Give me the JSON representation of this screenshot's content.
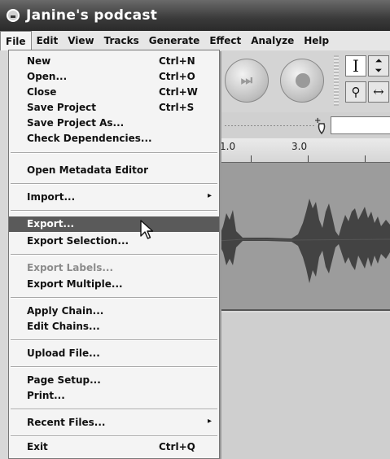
{
  "window": {
    "title": "Janine's podcast",
    "icon": "audacity-app-icon"
  },
  "menubar": {
    "items": [
      {
        "label": "File",
        "active": true
      },
      {
        "label": "Edit"
      },
      {
        "label": "View"
      },
      {
        "label": "Tracks"
      },
      {
        "label": "Generate"
      },
      {
        "label": "Effect"
      },
      {
        "label": "Analyze"
      },
      {
        "label": "Help"
      }
    ]
  },
  "file_menu": {
    "items": [
      {
        "label": "New",
        "accel": "Ctrl+N"
      },
      {
        "label": "Open...",
        "accel": "Ctrl+O"
      },
      {
        "label": "Close",
        "accel": "Ctrl+W"
      },
      {
        "label": "Save Project",
        "accel": "Ctrl+S"
      },
      {
        "label": "Save Project As..."
      },
      {
        "label": "Check Dependencies..."
      },
      {
        "label": "Open Metadata Editor"
      },
      {
        "label": "Import...",
        "submenu": true
      },
      {
        "label": "Export...",
        "highlighted": true
      },
      {
        "label": "Export Selection..."
      },
      {
        "label": "Export Labels...",
        "disabled": true
      },
      {
        "label": "Export Multiple..."
      },
      {
        "label": "Apply Chain..."
      },
      {
        "label": "Edit Chains..."
      },
      {
        "label": "Upload File..."
      },
      {
        "label": "Page Setup..."
      },
      {
        "label": "Print..."
      },
      {
        "label": "Recent Files...",
        "submenu": true
      },
      {
        "label": "Exit",
        "accel": "Ctrl+Q"
      }
    ],
    "submenu_arrow": "▸"
  },
  "toolbar": {
    "buttons": [
      {
        "name": "skip-to-end",
        "glyph": "⏭"
      },
      {
        "name": "record"
      }
    ],
    "tools": [
      "I",
      "⇕",
      "🔍",
      "↔"
    ]
  },
  "ruler": {
    "labels": [
      "1.0",
      "3.0"
    ]
  },
  "colors": {
    "highlight": "#5a5a5a",
    "track_bg": "#9c9c9c",
    "waveform": "#3a3a3a"
  }
}
